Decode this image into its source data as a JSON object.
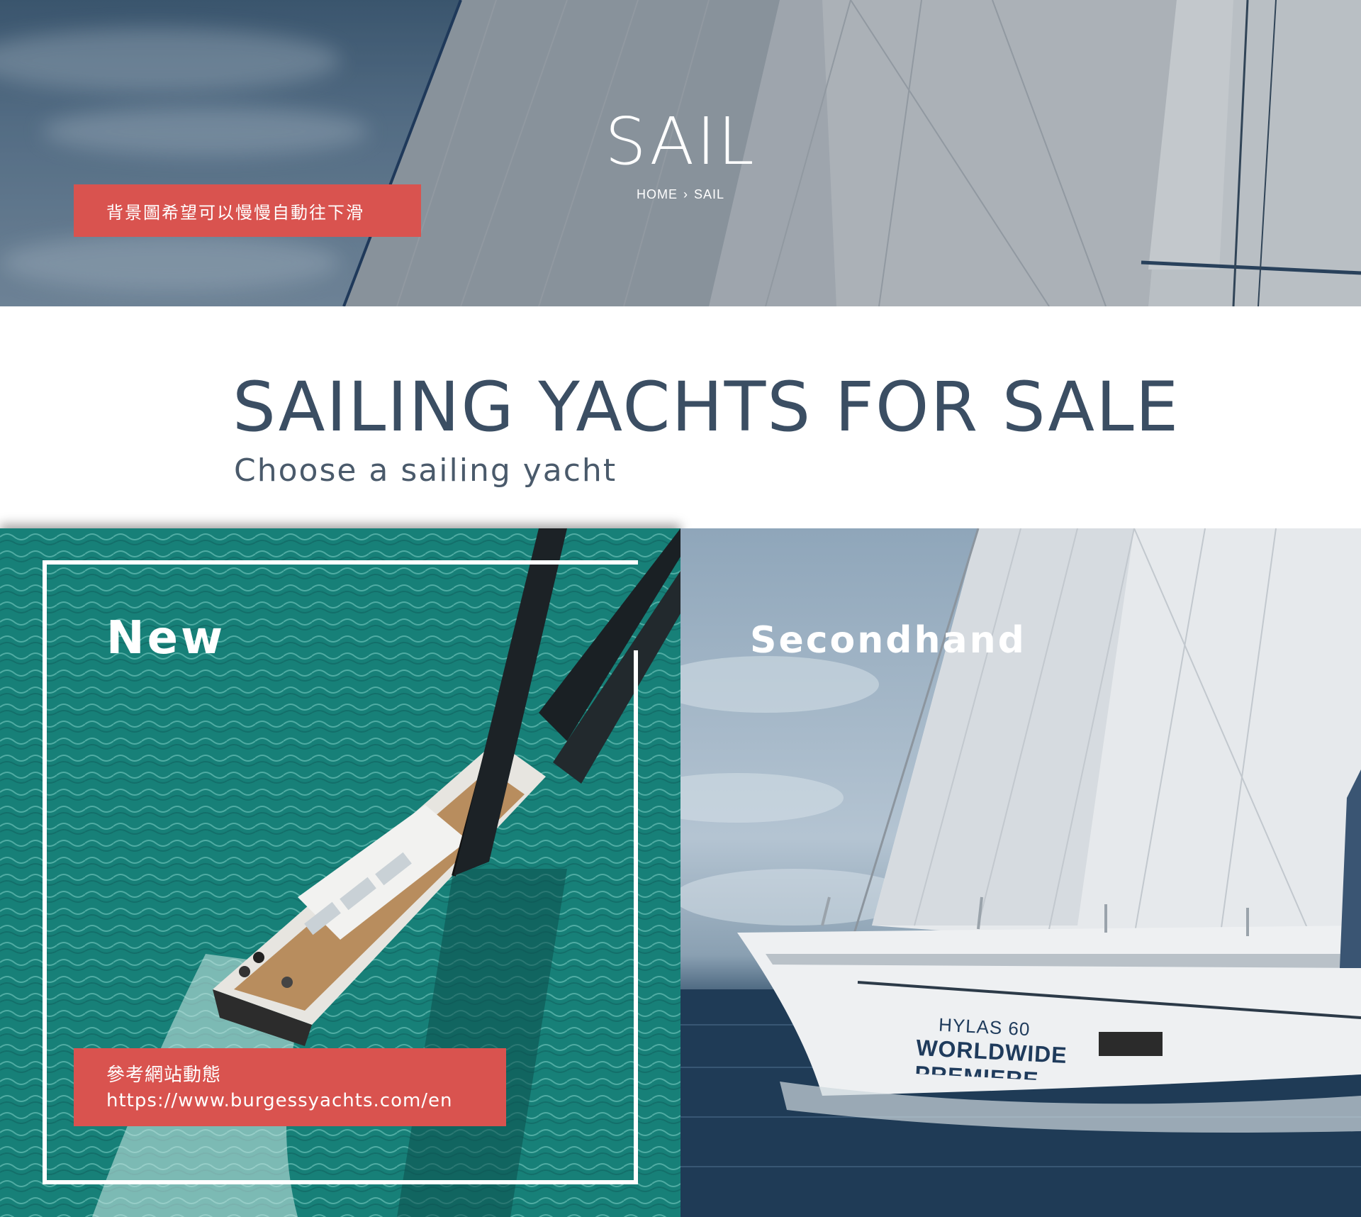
{
  "hero": {
    "title": "SAIL",
    "breadcrumb": {
      "home": "HOME",
      "separator": "›",
      "current": "SAIL"
    },
    "note": "背景圖希望可以慢慢自動往下滑"
  },
  "section": {
    "title": "SAILING YACHTS FOR SALE",
    "subtitle": "Choose a sailing yacht"
  },
  "cards": {
    "new": {
      "label": "New",
      "note_line1": "參考網站動態",
      "note_line2": "https://www.burgessyachts.com/en"
    },
    "secondhand": {
      "label": "Secondhand",
      "hull_brand": "HYLAS 60",
      "hull_text1": "WORLDWIDE",
      "hull_text2": "PREMIERE"
    }
  },
  "colors": {
    "accent": "#d9534f",
    "heading": "#3b4e63",
    "sea_green": "#1a7f7b",
    "white": "#ffffff"
  }
}
